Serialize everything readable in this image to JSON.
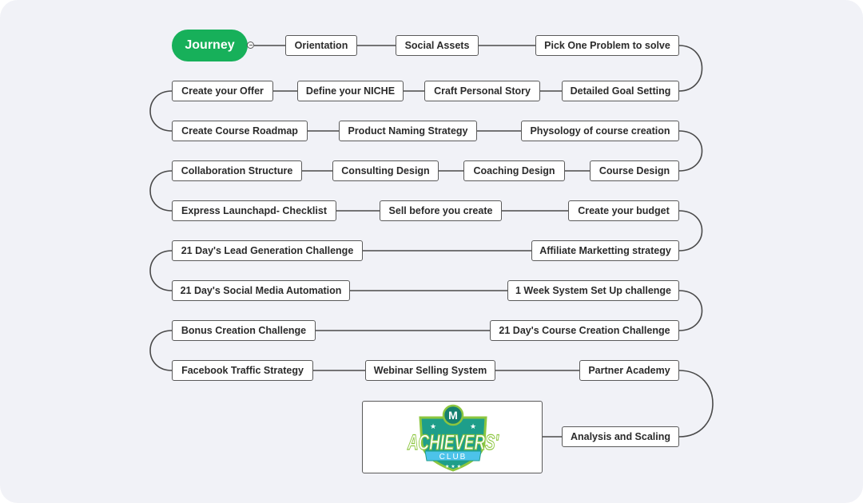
{
  "diagram": {
    "type": "mind-map",
    "root": {
      "label": "Journey",
      "color": "#17b05a",
      "collapse_icon": "minus-circle-icon"
    },
    "nodes": [
      {
        "id": "n1",
        "label": "Orientation"
      },
      {
        "id": "n2",
        "label": "Social Assets"
      },
      {
        "id": "n3",
        "label": "Pick One Problem to solve"
      },
      {
        "id": "n4",
        "label": "Detailed Goal Setting"
      },
      {
        "id": "n5",
        "label": "Craft Personal Story"
      },
      {
        "id": "n6",
        "label": "Define your NICHE"
      },
      {
        "id": "n7",
        "label": "Create your Offer"
      },
      {
        "id": "n8",
        "label": "Create Course Roadmap"
      },
      {
        "id": "n9",
        "label": "Product Naming Strategy"
      },
      {
        "id": "n10",
        "label": "Physology of course creation"
      },
      {
        "id": "n11",
        "label": "Course Design"
      },
      {
        "id": "n12",
        "label": "Coaching Design"
      },
      {
        "id": "n13",
        "label": "Consulting Design"
      },
      {
        "id": "n14",
        "label": "Collaboration Structure"
      },
      {
        "id": "n15",
        "label": "Express Launchapd- Checklist"
      },
      {
        "id": "n16",
        "label": "Sell before you create"
      },
      {
        "id": "n17",
        "label": "Create your budget"
      },
      {
        "id": "n18",
        "label": "Affiliate Marketting strategy"
      },
      {
        "id": "n19",
        "label": "21 Day's Lead Generation Challenge"
      },
      {
        "id": "n20",
        "label": "21 Day's Social Media Automation"
      },
      {
        "id": "n21",
        "label": "1 Week System Set Up challenge"
      },
      {
        "id": "n22",
        "label": "21 Day's Course Creation Challenge"
      },
      {
        "id": "n23",
        "label": "Bonus Creation Challenge"
      },
      {
        "id": "n24",
        "label": "Facebook Traffic Strategy"
      },
      {
        "id": "n25",
        "label": "Webinar Selling System"
      },
      {
        "id": "n26",
        "label": "Partner Academy"
      },
      {
        "id": "n27",
        "label": "Analysis and Scaling"
      }
    ],
    "end_image": {
      "alt": "Achievers' Club logo",
      "title_text": "ACHIEVERS'",
      "ribbon_text": "CLUB",
      "monogram": "M",
      "colors": {
        "shield": "#1e9e8a",
        "rim": "#8cc63f",
        "ribbon": "#4cc3ea",
        "letters": "#ffffff"
      }
    },
    "connector_color": "#4a4a4a"
  }
}
